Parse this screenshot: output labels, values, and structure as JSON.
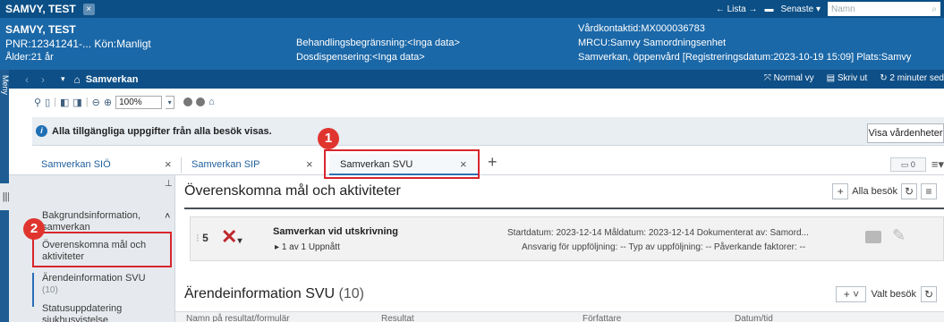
{
  "titlebar": {
    "patient": "SAMVY, TEST",
    "close_icon": "close-icon",
    "lista": "← Lista →",
    "senaste": "Senaste ▾",
    "search_placeholder": "Namn"
  },
  "patient": {
    "name": "SAMVY, TEST",
    "pnr": "PNR:12341241-...  Kön:Manligt",
    "age": "Ålder:21 år",
    "behandling": "Behandlingsbegränsning:<Inga data>",
    "dosdispensering": "Dosdispensering:<Inga data>",
    "vardkontakt": "Vårdkontaktid:MX000036783",
    "mrcu": "MRCU:Samvy Samordningsenhet",
    "samverkan": "Samverkan, öppenvård [Registreringsdatum:2023-10-19 15:09] Plats:Samvy"
  },
  "nav": {
    "meny": "Meny",
    "title": "Samverkan",
    "normal_vy": "Normal vy",
    "skriv_ut": "Skriv ut",
    "refresh": "2 minuter sed"
  },
  "toolbar": {
    "zoom": "100%"
  },
  "info": {
    "text": "Alla tillgängliga uppgifter från alla besök visas.",
    "button": "Visa vårdenheter"
  },
  "tabs": [
    {
      "label": "Samverkan SIÖ"
    },
    {
      "label": "Samverkan SIP"
    },
    {
      "label": "Samverkan SVU"
    }
  ],
  "tabbar_right": {
    "badge": "0"
  },
  "sidebar": {
    "items": [
      {
        "label": "Bakgrundsinformation, samverkan"
      },
      {
        "label": "Överenskomna mål och aktiviteter"
      },
      {
        "label": "Ärendeinformation SVU",
        "sub": "(10)"
      },
      {
        "label": "Statusuppdatering sjukhusvistelse"
      }
    ]
  },
  "section1": {
    "title": "Överenskomna mål och aktiviteter",
    "alla_besok": "Alla besök"
  },
  "card": {
    "num": "5",
    "title": "Samverkan vid utskrivning",
    "sub": "1 av 1 Uppnått",
    "meta1": "Startdatum: 2023-12-14    Måldatum: 2023-12-14    Dokumenterat av: Samord...",
    "meta2": "Ansvarig för uppföljning: --    Typ av uppföljning: --    Påverkande faktorer: --"
  },
  "section2": {
    "title": "Ärendeinformation SVU",
    "count": "(10)",
    "valt_besok": "Valt besök"
  },
  "table": {
    "columns": [
      "Namn på resultat/formulär",
      "Resultat",
      "Författare",
      "Datum/tid"
    ]
  },
  "annotations": {
    "one": "1",
    "two": "2"
  },
  "colors": {
    "title_bar": "#0b4f86",
    "patient_bar": "#1b68a8",
    "accent": "#2a6fb5",
    "annotation": "#d8262e"
  }
}
